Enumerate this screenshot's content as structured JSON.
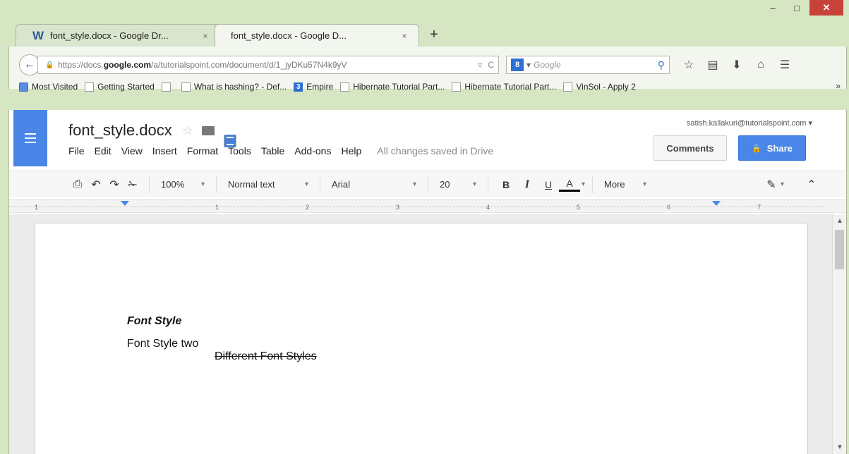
{
  "window": {
    "controls": {
      "minimize": "–",
      "maximize": "□",
      "close": "✕"
    }
  },
  "tabs": [
    {
      "label": "font_style.docx - Google Dr...",
      "icon": "word-icon",
      "active": false
    },
    {
      "label": "font_style.docx - Google D...",
      "icon": "docs-icon",
      "active": true
    }
  ],
  "tab_close": "×",
  "new_tab": "+",
  "nav": {
    "url_prefix": "https://docs.",
    "url_domain": "google.com",
    "url_rest": "/a/tutorialspoint.com/document/d/1_jyDKu57N4k9yV",
    "search_engine_letter": "8",
    "search_placeholder": "Google"
  },
  "bookmarks": [
    "Most Visited",
    "Getting Started",
    "",
    "What is hashing? - Def...",
    "Empire",
    "Hibernate Tutorial Part...",
    "Hibernate Tutorial Part...",
    "VinSol - Apply 2"
  ],
  "bookmarks_more": "»",
  "docs": {
    "title": "font_style.docx",
    "menu": [
      "File",
      "Edit",
      "View",
      "Insert",
      "Format",
      "Tools",
      "Table",
      "Add-ons",
      "Help"
    ],
    "save_status": "All changes saved in Drive",
    "user_email": "satish.kallakuri@tutorialspoint.com",
    "comments_label": "Comments",
    "share_label": "Share"
  },
  "toolbar": {
    "zoom": "100%",
    "style": "Normal text",
    "font": "Arial",
    "size": "20",
    "bold": "B",
    "italic": "I",
    "underline": "U",
    "text_color": "A",
    "more": "More"
  },
  "ruler_ticks": [
    "1",
    "1",
    "2",
    "3",
    "4",
    "5",
    "6",
    "7"
  ],
  "document": {
    "heading": "Font Style",
    "line2": "Font Style two",
    "strikethrough": "Different Font Styles"
  },
  "colors": {
    "accent": "#4a86e8",
    "close_button": "#c9423a"
  }
}
